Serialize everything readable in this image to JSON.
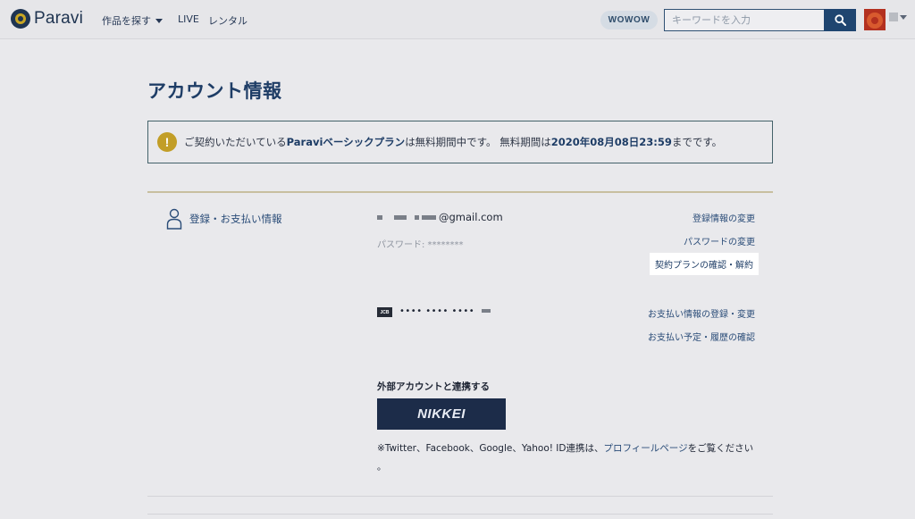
{
  "header": {
    "logo_text": "Paravi",
    "nav": {
      "browse": "作品を探す",
      "live": "LIVE",
      "rental": "レンタル"
    },
    "wowow_badge": "WOWOW",
    "search_placeholder": "キーワードを入力"
  },
  "page_title": "アカウント情報",
  "notice": {
    "icon": "!",
    "text_before": "ご契約いただいている",
    "plan": "Paraviベーシックプラン",
    "text_mid": "は無料期間中です。 無料期間は",
    "date": "2020年08月08日23:59",
    "text_after": "までです。"
  },
  "section": {
    "label": "登録・お支払い情報"
  },
  "account": {
    "email_suffix": "@gmail.com",
    "password": "パスワード: ********"
  },
  "links": {
    "change_registration": "登録情報の変更",
    "change_password": "パスワードの変更",
    "plan_confirm_cancel": "契約プランの確認・解約",
    "payment_register_change": "お支払い情報の登録・変更",
    "payment_schedule_history": "お支払い予定・履歴の確認"
  },
  "card": {
    "brand": "JCB",
    "number": "•••• •••• ••••"
  },
  "external": {
    "heading": "外部アカウントと連携する",
    "nikkei_button": "NIKKEI",
    "note_before": "※Twitter、Facebook、Google、Yahoo! ID連携は、",
    "note_link": "プロフィールページ",
    "note_after": "をご覧ください",
    "note_end": "。"
  },
  "colors": {
    "accent": "#1e3d66",
    "warning": "#c29e27",
    "link": "#2a4c78"
  }
}
